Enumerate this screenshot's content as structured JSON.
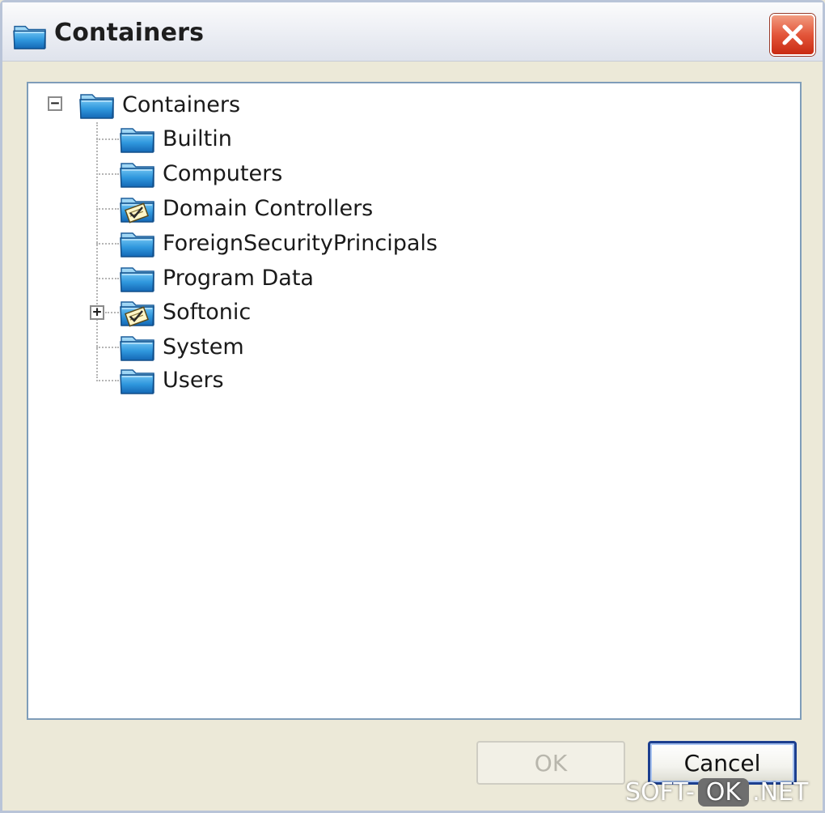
{
  "window": {
    "title": "Containers",
    "close_icon": "close-icon"
  },
  "tree": {
    "root": {
      "label": "Containers",
      "expanded": true,
      "icon": "folder-icon"
    },
    "children": [
      {
        "label": "Builtin",
        "icon": "folder-icon",
        "has_children": false
      },
      {
        "label": "Computers",
        "icon": "folder-icon",
        "has_children": false
      },
      {
        "label": "Domain Controllers",
        "icon": "folder-policy-icon",
        "has_children": false
      },
      {
        "label": "ForeignSecurityPrincipals",
        "icon": "folder-icon",
        "has_children": false
      },
      {
        "label": "Program Data",
        "icon": "folder-icon",
        "has_children": false
      },
      {
        "label": "Softonic",
        "icon": "folder-policy-icon",
        "has_children": true
      },
      {
        "label": "System",
        "icon": "folder-icon",
        "has_children": false
      },
      {
        "label": "Users",
        "icon": "folder-icon",
        "has_children": false
      }
    ]
  },
  "buttons": {
    "ok_label": "OK",
    "ok_enabled": false,
    "cancel_label": "Cancel"
  },
  "watermark": {
    "part1": "SOFT-",
    "part2": "OK",
    "part3": ".NET"
  },
  "colors": {
    "dialog_bg": "#ece9d8",
    "panel_border": "#7f9db9",
    "close_red": "#e3563a",
    "default_button_border": "#1c3f8f"
  }
}
